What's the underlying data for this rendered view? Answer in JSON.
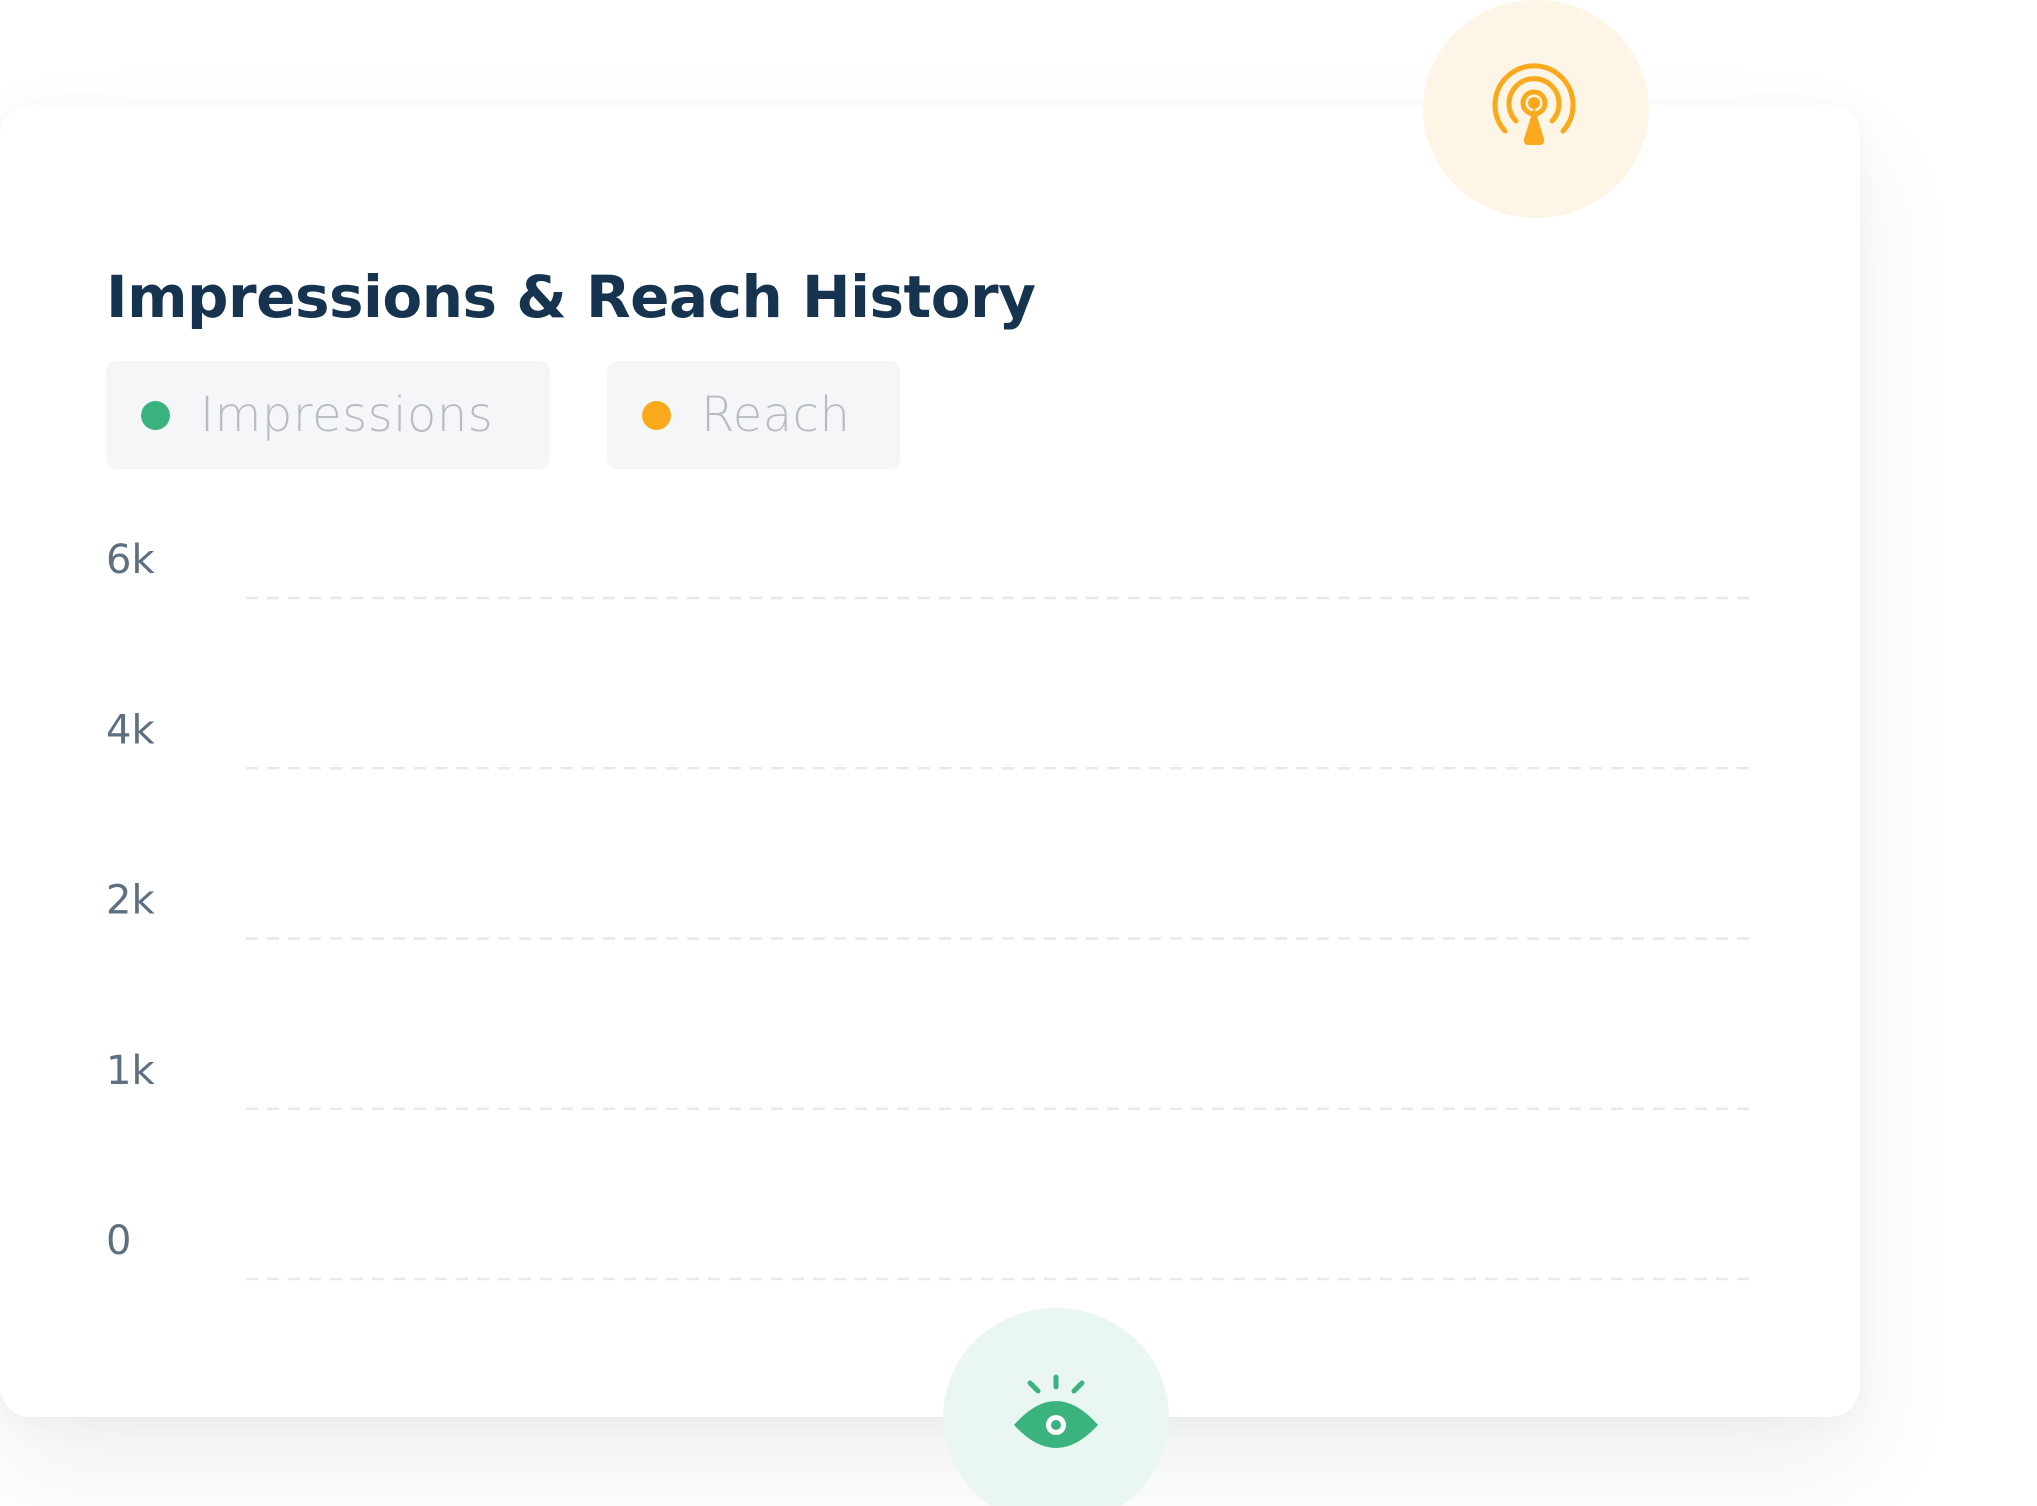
{
  "chart_data": {
    "type": "line",
    "title": "Impressions & Reach History",
    "series": [
      {
        "name": "Impressions",
        "color": "#3bb37f",
        "values": []
      },
      {
        "name": "Reach",
        "color": "#f9a91b",
        "values": []
      }
    ],
    "x": [],
    "y_ticks": [
      "0",
      "1k",
      "2k",
      "4k",
      "6k"
    ],
    "grid": true,
    "grid_style": "dashed",
    "legend_position": "top-left",
    "xlabel": "",
    "ylabel": ""
  },
  "badges": {
    "top": {
      "icon": "broadcast-tower-icon",
      "color": "#f9a91b",
      "background": "#fdf5e6"
    },
    "bottom": {
      "icon": "eye-icon",
      "color": "#3bb37f",
      "background": "#eaf6f1"
    }
  }
}
